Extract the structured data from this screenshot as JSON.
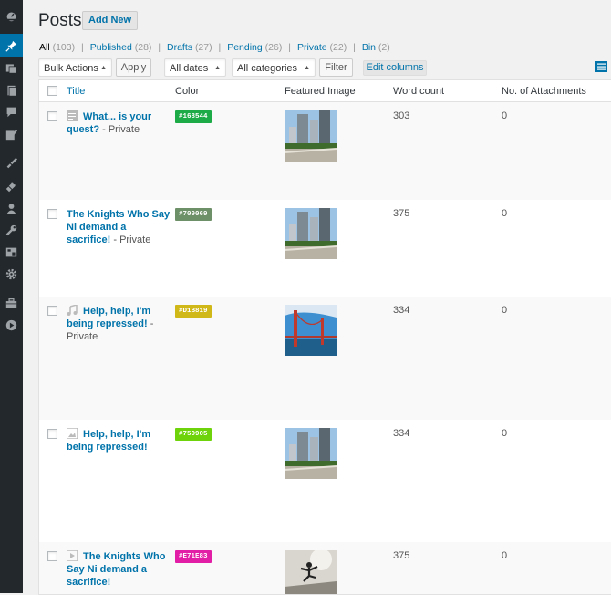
{
  "sidebar": {
    "icons": [
      "dashboard-icon",
      "posts-icon",
      "media-icon",
      "pages-icon",
      "comments-icon",
      "feedback-icon",
      "appearance-icon",
      "plugins-icon",
      "users-icon",
      "tools-icon",
      "settings-icon",
      "gear-icon",
      "toolbox-icon",
      "play-icon"
    ]
  },
  "header": {
    "title": "Posts",
    "add_new_label": "Add New"
  },
  "filters": {
    "all": {
      "label": "All",
      "count": "(103)"
    },
    "published": {
      "label": "Published",
      "count": "(28)"
    },
    "drafts": {
      "label": "Drafts",
      "count": "(27)"
    },
    "pending": {
      "label": "Pending",
      "count": "(26)"
    },
    "private": {
      "label": "Private",
      "count": "(22)"
    },
    "bin": {
      "label": "Bin",
      "count": "(2)"
    },
    "separator": "|"
  },
  "toolbar": {
    "bulk_actions": "Bulk Actions",
    "apply": "Apply",
    "all_dates": "All dates",
    "all_categories": "All categories",
    "filter": "Filter",
    "edit_columns": "Edit columns"
  },
  "columns": {
    "title": "Title",
    "color": "Color",
    "featured_image": "Featured Image",
    "word_count": "Word count",
    "attachments": "No. of Attachments"
  },
  "rows": [
    {
      "title": "What... is your quest?",
      "status": " - Private",
      "format_icon": "standard-post-icon",
      "color_label": "#168544",
      "color": "#1cab46",
      "image": "city-park",
      "word_count": "303",
      "attachments": "0"
    },
    {
      "title": "The Knights Who Say Ni demand a sacrifice!",
      "status": " - Private",
      "format_icon": "",
      "color_label": "#709069",
      "color": "#6e9068",
      "image": "city-park",
      "word_count": "375",
      "attachments": "0"
    },
    {
      "title": "Help, help, I'm being repressed!",
      "status": " - Private",
      "format_icon": "music-icon",
      "color_label": "#D1B819",
      "color": "#d1b819",
      "image": "golden-gate-bridge",
      "word_count": "334",
      "attachments": "0"
    },
    {
      "title": "Help, help, I'm being repressed!",
      "status": "",
      "format_icon": "image-icon",
      "color_label": "#75D905",
      "color": "#6fd30b",
      "image": "city-park",
      "word_count": "334",
      "attachments": "0"
    },
    {
      "title": "The Knights Who Say Ni demand a sacrifice!",
      "status": "",
      "format_icon": "video-icon",
      "color_label": "#E71E83",
      "color": "#e31ea6",
      "image": "jumping-person",
      "word_count": "375",
      "attachments": "0"
    }
  ]
}
